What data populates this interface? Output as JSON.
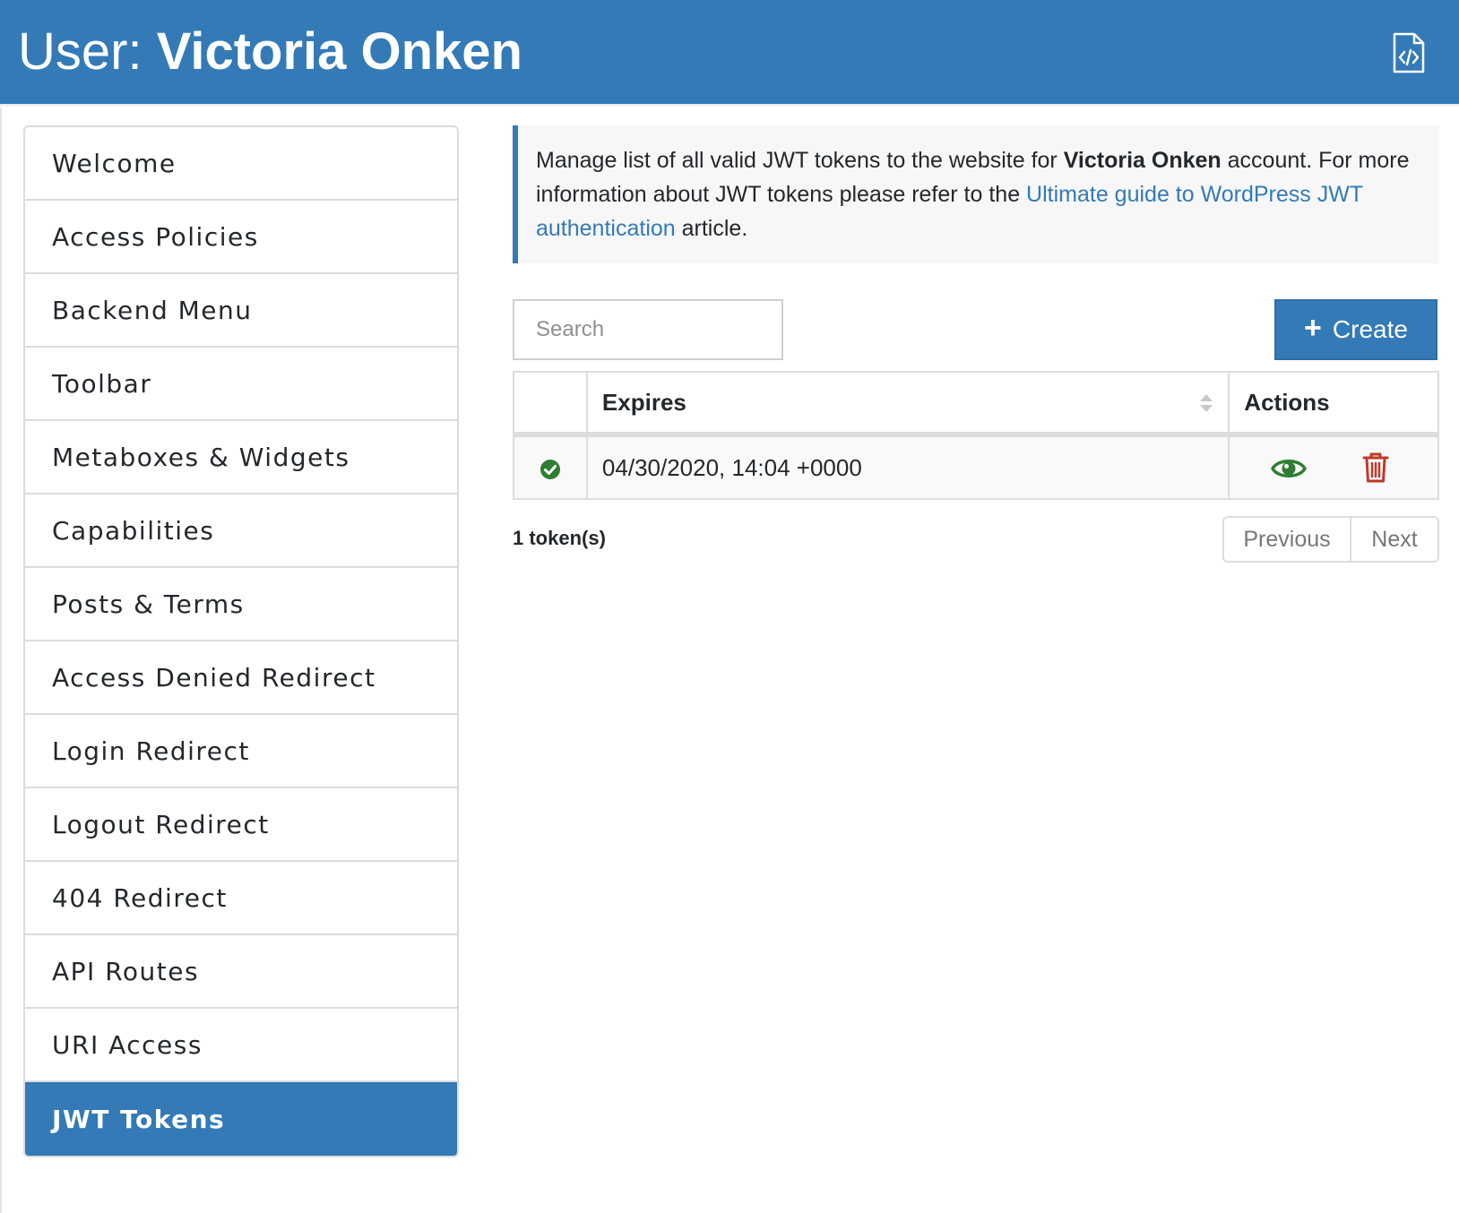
{
  "header": {
    "title_prefix": "User: ",
    "title_name": "Victoria Onken",
    "export_icon": "code-file-icon"
  },
  "sidebar": {
    "items": [
      {
        "label": "Welcome",
        "active": false
      },
      {
        "label": "Access Policies",
        "active": false
      },
      {
        "label": "Backend Menu",
        "active": false
      },
      {
        "label": "Toolbar",
        "active": false
      },
      {
        "label": "Metaboxes & Widgets",
        "active": false
      },
      {
        "label": "Capabilities",
        "active": false
      },
      {
        "label": "Posts & Terms",
        "active": false
      },
      {
        "label": "Access Denied Redirect",
        "active": false
      },
      {
        "label": "Login Redirect",
        "active": false
      },
      {
        "label": "Logout Redirect",
        "active": false
      },
      {
        "label": "404 Redirect",
        "active": false
      },
      {
        "label": "API Routes",
        "active": false
      },
      {
        "label": "URI Access",
        "active": false
      },
      {
        "label": "JWT Tokens",
        "active": true
      }
    ]
  },
  "info": {
    "text_1": "Manage list of all valid JWT tokens to the website for ",
    "account_name": "Victoria Onken",
    "text_2": " account. For more information about JWT tokens please refer to the ",
    "link_text": "Ultimate guide to WordPress JWT authentication",
    "text_3": " article."
  },
  "search": {
    "placeholder": "Search",
    "value": ""
  },
  "create_button": {
    "label": "Create",
    "icon": "plus-icon"
  },
  "table": {
    "headers": {
      "status": "",
      "expires": "Expires",
      "actions": "Actions"
    },
    "rows": [
      {
        "status_icon": "check-circle-icon",
        "expires": "04/30/2020, 14:04 +0000",
        "actions": [
          "view-eye-icon",
          "delete-trash-icon"
        ]
      }
    ]
  },
  "footer": {
    "count": "1 token(s)",
    "previous": "Previous",
    "next": "Next"
  },
  "colors": {
    "primary": "#337ab7",
    "success": "#2e7d32",
    "danger": "#c0392b",
    "muted": "#777777"
  }
}
